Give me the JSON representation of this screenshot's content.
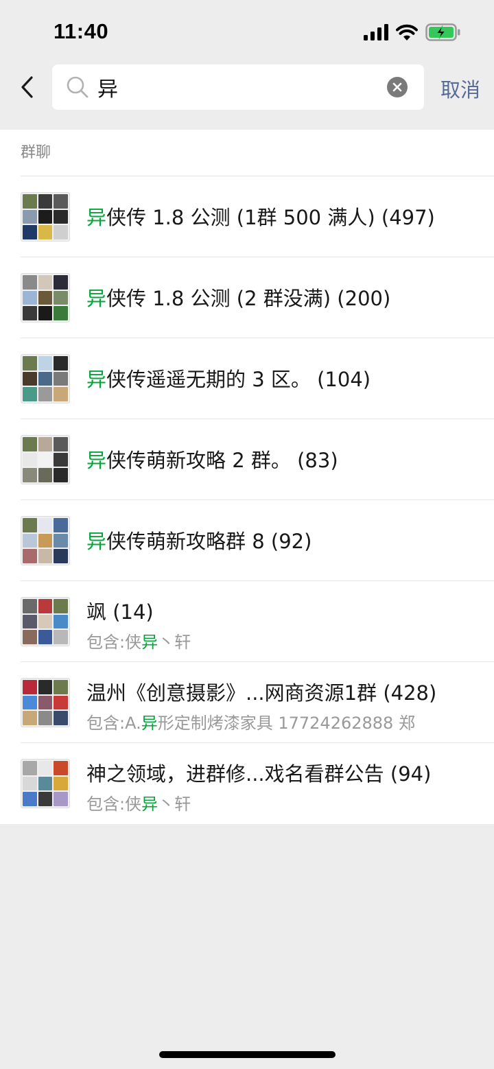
{
  "status_bar": {
    "time": "11:40"
  },
  "search": {
    "query": "异",
    "cancel_label": "取消"
  },
  "section": {
    "label": "群聊"
  },
  "groups": [
    {
      "highlight": "异",
      "title_rest": "侠传 1.8 公测 (1群 500 满人) (497)"
    },
    {
      "highlight": "异",
      "title_rest": "侠传 1.8 公测 (2 群没满) (200)"
    },
    {
      "highlight": "异",
      "title_rest": "侠传遥遥无期的 3 区。 (104)"
    },
    {
      "highlight": "异",
      "title_rest": "侠传萌新攻略 2 群。 (83)"
    },
    {
      "highlight": "异",
      "title_rest": "侠传萌新攻略群 8 (92)"
    },
    {
      "title": "飒 (14)",
      "sub_pre": "包含:侠",
      "sub_hl": "异",
      "sub_post": "丶轩"
    },
    {
      "title": "温州《创意摄影》...网商资源1群 (428)",
      "sub_pre": "包含:A.",
      "sub_hl": "异",
      "sub_post": "形定制烤漆家具 17724262888 郑"
    },
    {
      "title": "神之领域，进群修...戏名看群公告 (94)",
      "sub_pre": "包含:侠",
      "sub_hl": "异",
      "sub_post": "丶轩"
    }
  ],
  "colors": {
    "highlight": "#07a43b",
    "link": "#576b95",
    "background": "#ededed"
  },
  "icons": [
    "back-arrow-icon",
    "search-icon",
    "clear-icon",
    "signal-icon",
    "wifi-icon",
    "battery-charging-icon"
  ]
}
